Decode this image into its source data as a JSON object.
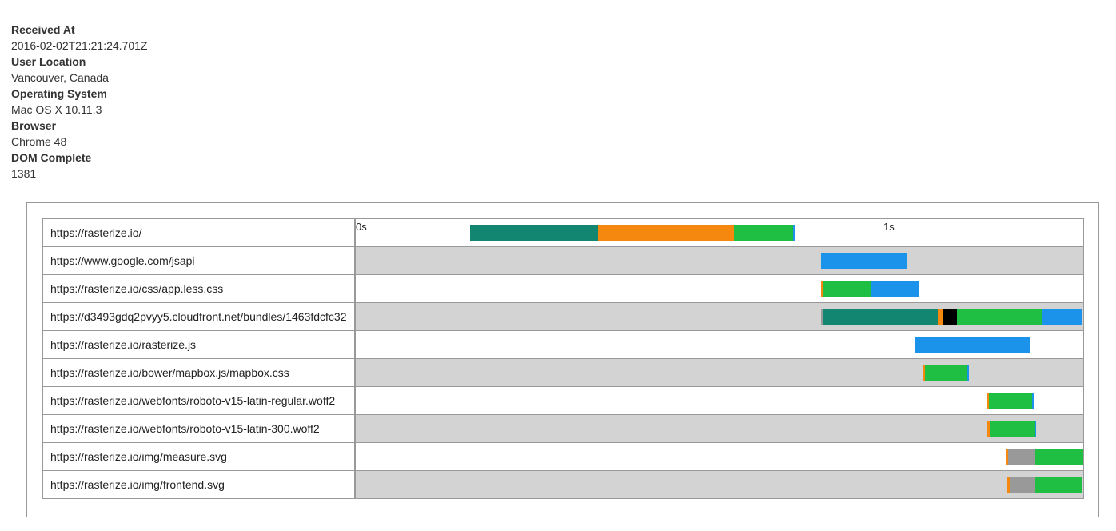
{
  "meta": [
    {
      "label": "Received At",
      "value": "2016-02-02T21:21:24.701Z"
    },
    {
      "label": "User Location",
      "value": "Vancouver, Canada"
    },
    {
      "label": "Operating System",
      "value": "Mac OS X 10.11.3"
    },
    {
      "label": "Browser",
      "value": "Chrome 48"
    },
    {
      "label": "DOM Complete",
      "value": "1381"
    }
  ],
  "chart_data": {
    "type": "bar",
    "subtype": "waterfall",
    "ticks": [
      {
        "value": 0,
        "label": "0s"
      },
      {
        "value": 1000,
        "label": "1s"
      }
    ],
    "xlim": [
      0,
      1380
    ],
    "phase_colors": {
      "dns": "#138672",
      "connect": "#f5880e",
      "ssl": "#000000",
      "wait": "#999999",
      "ttfb": "#1ebf42",
      "download": "#1c93ea"
    },
    "requests": [
      {
        "url": "https://rasterize.io/",
        "segments": [
          {
            "phase": "dns",
            "start": 218,
            "end": 460
          },
          {
            "phase": "connect",
            "start": 460,
            "end": 718
          },
          {
            "phase": "ttfb",
            "start": 718,
            "end": 831
          },
          {
            "phase": "download",
            "start": 831,
            "end": 834
          }
        ]
      },
      {
        "url": "https://www.google.com/jsapi",
        "segments": [
          {
            "phase": "download",
            "start": 883,
            "end": 1046
          }
        ]
      },
      {
        "url": "https://rasterize.io/css/app.less.css",
        "segments": [
          {
            "phase": "connect",
            "start": 883,
            "end": 888
          },
          {
            "phase": "ttfb",
            "start": 888,
            "end": 979
          },
          {
            "phase": "download",
            "start": 979,
            "end": 1070
          }
        ]
      },
      {
        "url": "https://d3493gdq2pvyy5.cloudfront.net/bundles/1463fdcfc32",
        "segments": [
          {
            "phase": "wait",
            "start": 884,
            "end": 887
          },
          {
            "phase": "dns",
            "start": 887,
            "end": 1104
          },
          {
            "phase": "connect",
            "start": 1104,
            "end": 1114
          },
          {
            "phase": "ssl",
            "start": 1114,
            "end": 1141
          },
          {
            "phase": "ttfb",
            "start": 1141,
            "end": 1303
          },
          {
            "phase": "download",
            "start": 1303,
            "end": 1377
          }
        ]
      },
      {
        "url": "https://rasterize.io/rasterize.js",
        "segments": [
          {
            "phase": "download",
            "start": 1060,
            "end": 1280
          }
        ]
      },
      {
        "url": "https://rasterize.io/bower/mapbox.js/mapbox.css",
        "segments": [
          {
            "phase": "connect",
            "start": 1077,
            "end": 1080
          },
          {
            "phase": "ttfb",
            "start": 1080,
            "end": 1160
          },
          {
            "phase": "download",
            "start": 1160,
            "end": 1163
          }
        ]
      },
      {
        "url": "https://rasterize.io/webfonts/roboto-v15-latin-regular.woff2",
        "segments": [
          {
            "phase": "connect",
            "start": 1198,
            "end": 1202
          },
          {
            "phase": "ttfb",
            "start": 1202,
            "end": 1284
          },
          {
            "phase": "download",
            "start": 1284,
            "end": 1287
          }
        ]
      },
      {
        "url": "https://rasterize.io/webfonts/roboto-v15-latin-300.woff2",
        "segments": [
          {
            "phase": "connect",
            "start": 1199,
            "end": 1203
          },
          {
            "phase": "ttfb",
            "start": 1203,
            "end": 1289
          },
          {
            "phase": "download",
            "start": 1289,
            "end": 1291
          }
        ]
      },
      {
        "url": "https://rasterize.io/img/measure.svg",
        "segments": [
          {
            "phase": "connect",
            "start": 1234,
            "end": 1238
          },
          {
            "phase": "wait",
            "start": 1238,
            "end": 1289
          },
          {
            "phase": "ttfb",
            "start": 1289,
            "end": 1380
          }
        ]
      },
      {
        "url": "https://rasterize.io/img/frontend.svg",
        "segments": [
          {
            "phase": "connect",
            "start": 1237,
            "end": 1241
          },
          {
            "phase": "wait",
            "start": 1241,
            "end": 1289
          },
          {
            "phase": "ttfb",
            "start": 1289,
            "end": 1377
          }
        ]
      }
    ]
  }
}
